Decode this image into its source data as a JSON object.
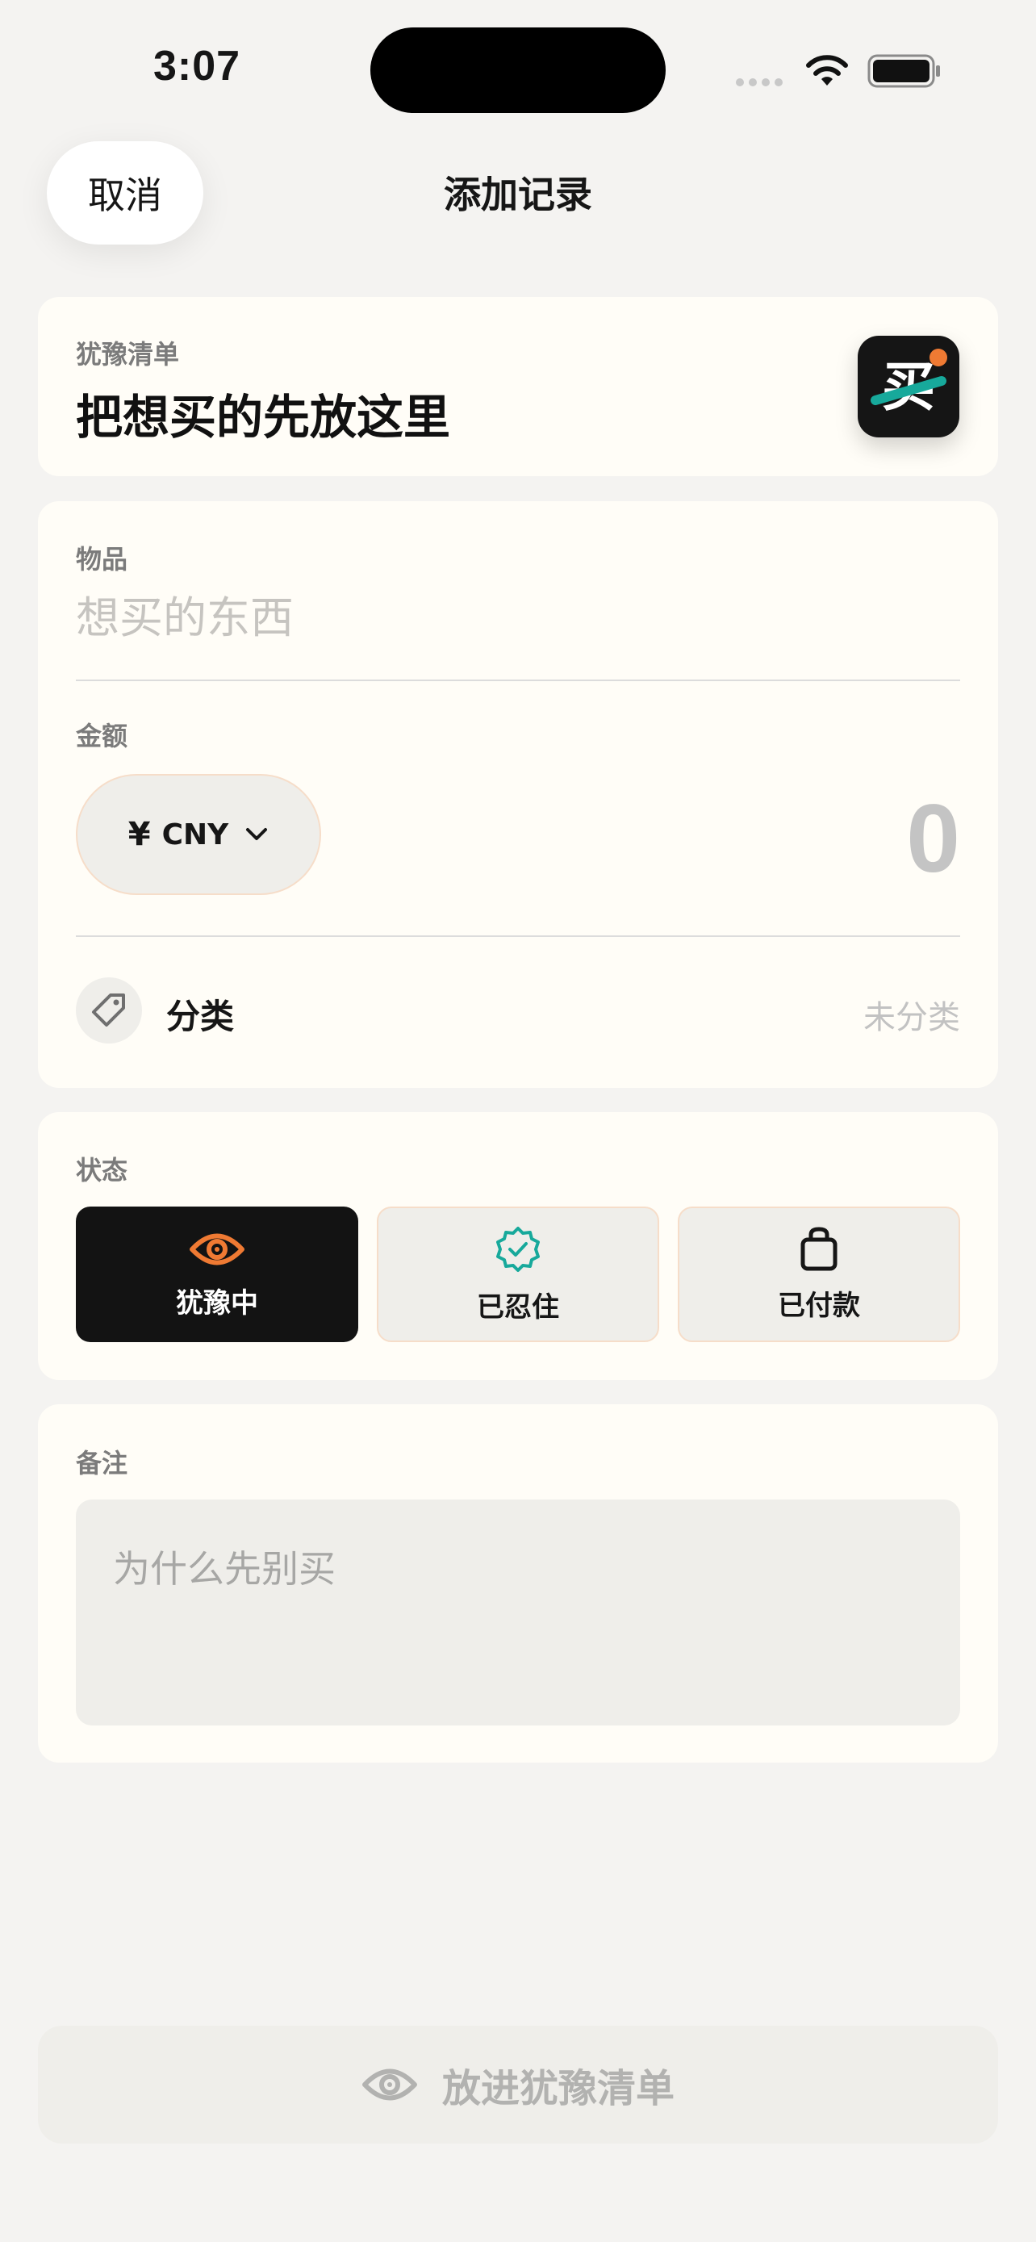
{
  "status_bar": {
    "time": "3:07",
    "wifi_icon": "wifi-icon",
    "battery_icon": "battery-icon",
    "battery_level": 1.0
  },
  "header": {
    "cancel_label": "取消",
    "title": "添加记录"
  },
  "hero": {
    "label": "犹豫清单",
    "title": "把想买的先放这里",
    "logo_text": "买",
    "logo_colors": {
      "background": "#151515",
      "stripe": "#17a99b",
      "dot": "#ef7a33"
    }
  },
  "item": {
    "label": "物品",
    "placeholder": "想买的东西",
    "value": ""
  },
  "amount": {
    "label": "金额",
    "currency_symbol": "¥",
    "currency_code": "CNY",
    "value": "0"
  },
  "category": {
    "icon": "tag-icon",
    "label": "分类",
    "value": "未分类"
  },
  "status": {
    "label": "状态",
    "selected": "hesitating",
    "options": [
      {
        "id": "hesitating",
        "label": "犹豫中",
        "icon": "eye-icon",
        "icon_color": "#ef7a33"
      },
      {
        "id": "resisted",
        "label": "已忍住",
        "icon": "verified-badge-icon",
        "icon_color": "#17a99b"
      },
      {
        "id": "paid",
        "label": "已付款",
        "icon": "shopping-bag-icon",
        "icon_color": "#161616"
      }
    ]
  },
  "note": {
    "label": "备注",
    "placeholder": "为什么先别买",
    "value": ""
  },
  "submit": {
    "label": "放进犹豫清单",
    "icon": "eye-icon",
    "enabled": false
  },
  "colors": {
    "page_background": "#f4f3f1",
    "card_background": "#fffdf7",
    "accent_orange": "#ef7a33",
    "accent_teal": "#17a99b",
    "selected_dark": "#131313"
  }
}
